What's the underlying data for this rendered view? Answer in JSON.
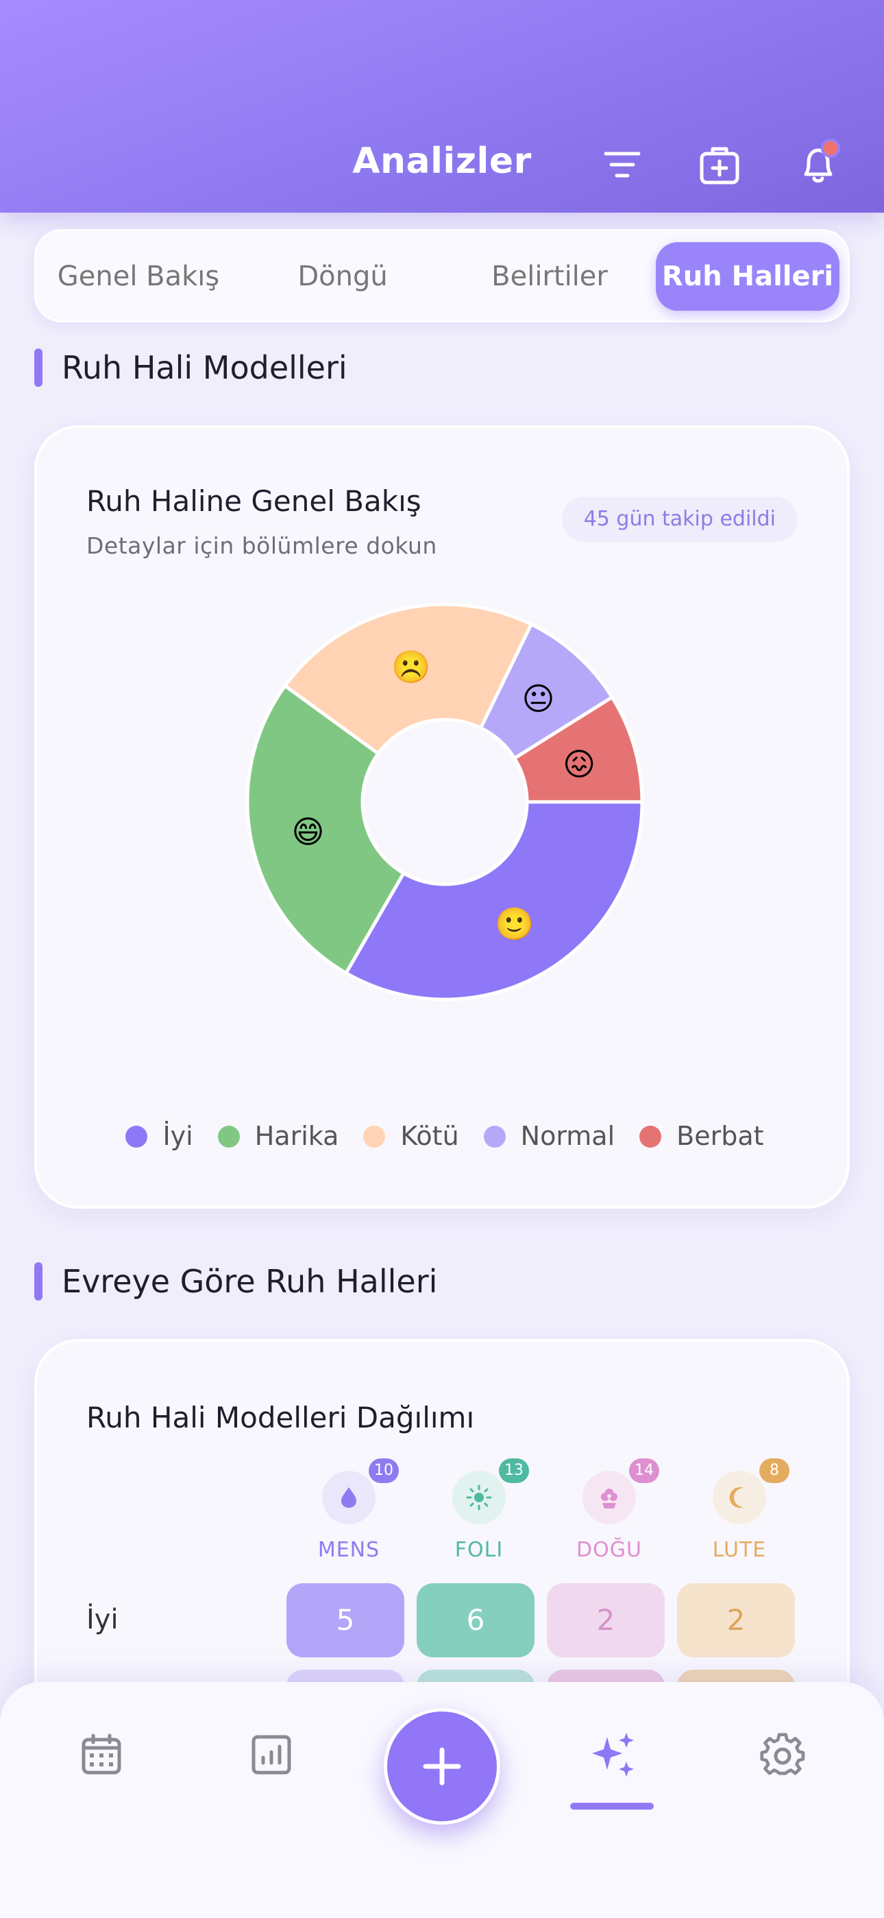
{
  "header": {
    "title": "Analizler"
  },
  "tabs": [
    {
      "label": "Genel Bakış"
    },
    {
      "label": "Döngü"
    },
    {
      "label": "Belirtiler"
    },
    {
      "label": "Ruh Halleri"
    }
  ],
  "active_tab": "Ruh Halleri",
  "mood_patterns": {
    "section_title": "Ruh Hali Modelleri",
    "card_title": "Ruh Haline Genel Bakış",
    "card_subtitle": "Detaylar için bölümlere dokun",
    "tracked_badge": "45 gün takip edildi"
  },
  "chart_data": {
    "type": "pie",
    "title": "",
    "donut": true,
    "categories": [
      "İyi",
      "Harika",
      "Kötü",
      "Normal",
      "Berbat"
    ],
    "values": [
      15,
      12,
      10,
      4,
      4
    ],
    "colors": [
      "#8e78f8",
      "#81c784",
      "#ffd3b3",
      "#b6a8f8",
      "#e57373"
    ],
    "emojis": [
      "🙂",
      "😄",
      "☹️",
      "😐",
      "😖"
    ],
    "legend_position": "bottom"
  },
  "phase_section": {
    "section_title": "Evreye Göre Ruh Halleri",
    "card_title": "Ruh Hali Modelleri Dağılımı",
    "phases": [
      {
        "label": "MENS",
        "count": "10",
        "icon": "drop-icon",
        "color": "#8f7bf0",
        "bg": "#ebe7fb"
      },
      {
        "label": "FOLI",
        "count": "13",
        "icon": "sun-icon",
        "color": "#4fb9a2",
        "bg": "#e2f3ef"
      },
      {
        "label": "DOĞU",
        "count": "14",
        "icon": "flower-icon",
        "color": "#de8fd0",
        "bg": "#f6e6f3"
      },
      {
        "label": "LUTE",
        "count": "8",
        "icon": "moon-icon",
        "color": "#e5ab5f",
        "bg": "#f7eee3"
      }
    ],
    "rows": [
      {
        "label": "İyi",
        "values": [
          "5",
          "6",
          "2",
          "2"
        ]
      }
    ]
  },
  "bottom_nav": {
    "items": [
      "calendar-icon",
      "chart-icon",
      "add-button",
      "sparkles-icon",
      "gear-icon"
    ],
    "active": "sparkles-icon"
  }
}
